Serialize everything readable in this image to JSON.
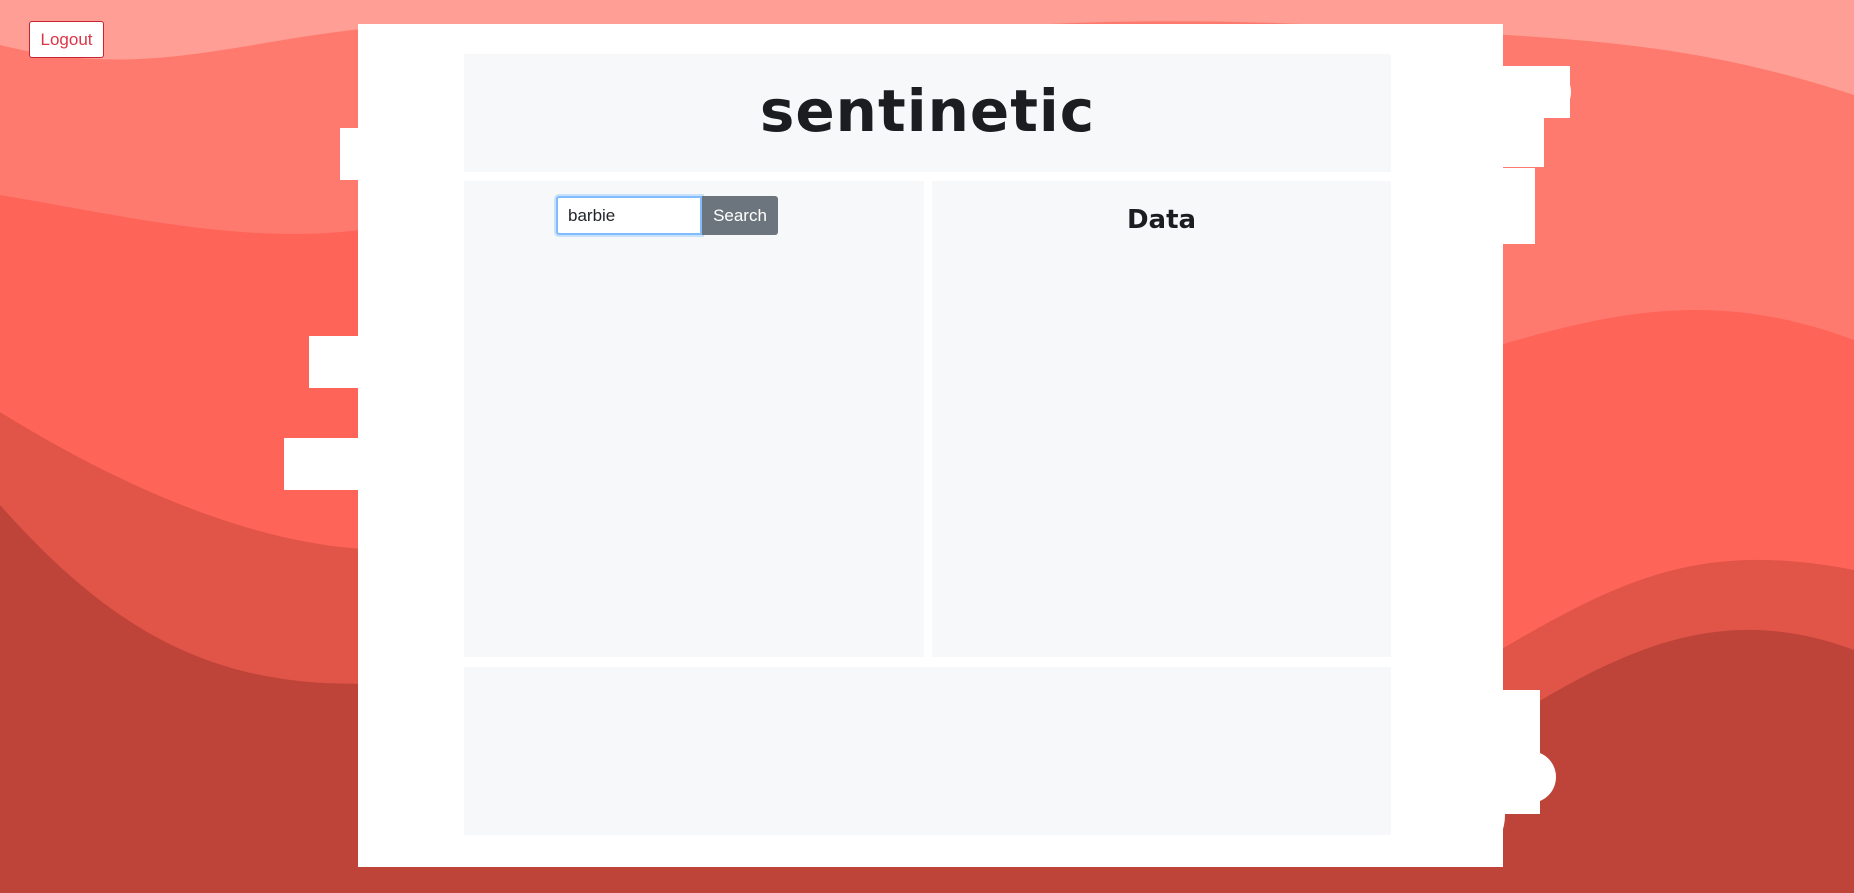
{
  "app": {
    "title": "sentinetic"
  },
  "header": {
    "logout_label": "Logout"
  },
  "search": {
    "value": "barbie",
    "button_label": "Search"
  },
  "data_panel": {
    "title": "Data"
  },
  "colors": {
    "wave_light": "#ff9e94",
    "wave_medium": "#ff7a6e",
    "wave_bright": "#ff6459",
    "wave_dark": "#e05548",
    "wave_darkest": "#be443a",
    "card_white": "#ffffff",
    "panel_bg": "#f7f8fa",
    "danger": "#dc3545",
    "secondary": "#6c757d"
  }
}
